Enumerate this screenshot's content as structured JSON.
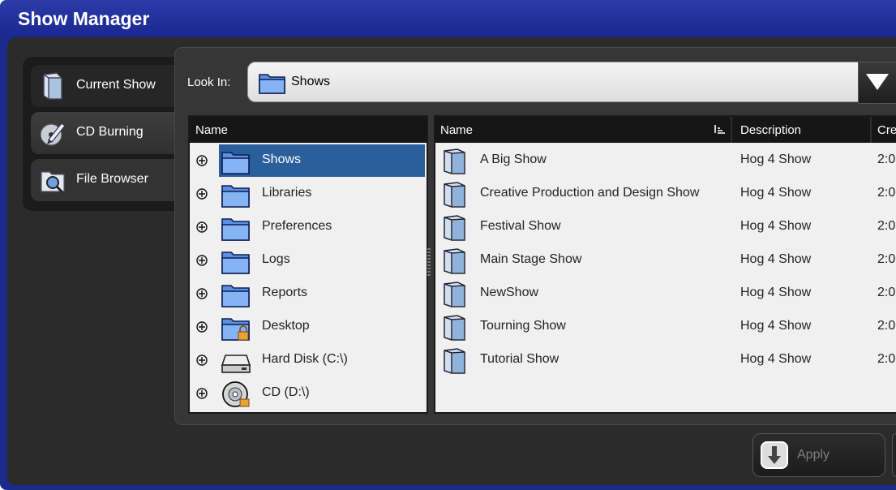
{
  "window": {
    "title": "Show Manager"
  },
  "tabs": [
    {
      "label": "Current Show",
      "icon": "show-book-icon"
    },
    {
      "label": "CD Burning",
      "icon": "cd-burn-icon"
    },
    {
      "label": "File Browser",
      "icon": "file-browser-icon"
    }
  ],
  "lookin": {
    "label": "Look In:",
    "value": "Shows"
  },
  "tree": {
    "header": "Name",
    "items": [
      {
        "label": "Shows",
        "icon": "folder-icon",
        "selected": true
      },
      {
        "label": "Libraries",
        "icon": "folder-icon"
      },
      {
        "label": "Preferences",
        "icon": "folder-icon"
      },
      {
        "label": "Logs",
        "icon": "folder-icon"
      },
      {
        "label": "Reports",
        "icon": "folder-icon"
      },
      {
        "label": "Desktop",
        "icon": "locked-folder-icon"
      },
      {
        "label": "Hard Disk (C:\\)",
        "icon": "hard-disk-icon"
      },
      {
        "label": "CD (D:\\)",
        "icon": "cd-drive-icon"
      }
    ]
  },
  "list": {
    "columns": [
      "Name",
      "Description",
      "Cre"
    ],
    "rows": [
      {
        "name": "A Big Show",
        "description": "Hog 4 Show",
        "created": "2:0"
      },
      {
        "name": "Creative Production and Design Show",
        "description": "Hog 4 Show",
        "created": "2:0"
      },
      {
        "name": "Festival Show",
        "description": "Hog 4 Show",
        "created": "2:0"
      },
      {
        "name": "Main Stage Show",
        "description": "Hog 4 Show",
        "created": "2:0"
      },
      {
        "name": "NewShow",
        "description": "Hog 4 Show",
        "created": "2:0"
      },
      {
        "name": "Tourning Show",
        "description": "Hog 4 Show",
        "created": "2:0"
      },
      {
        "name": "Tutorial Show",
        "description": "Hog 4 Show",
        "created": "2:0"
      }
    ]
  },
  "buttons": {
    "apply": "Apply"
  },
  "colors": {
    "titlebar": "#1c2a8c",
    "selection": "#2a5f9c",
    "panel": "#363636"
  }
}
